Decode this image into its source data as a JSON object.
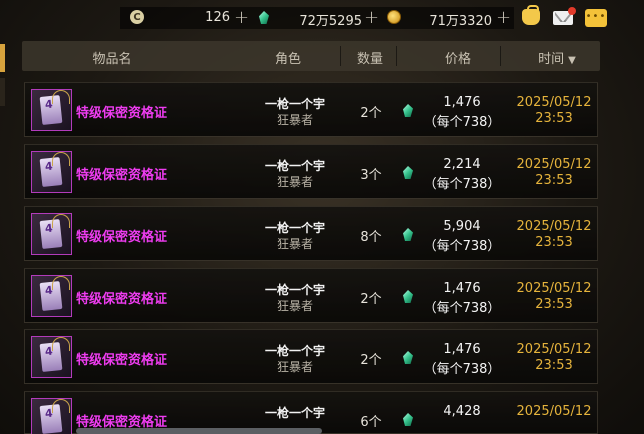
{
  "currencies": {
    "c_coin_label": "C",
    "c_coin_value": "126",
    "gem_value": "72万5295",
    "gold_value": "71万3320",
    "plus": "+"
  },
  "header_icons": {
    "chat_glyph": "•••"
  },
  "table": {
    "columns": [
      "物品名",
      "角色",
      "数量",
      "价格",
      "时间"
    ],
    "sort_indicator": "▼",
    "rows": [
      {
        "item": "特级保密资格证",
        "role": "一枪一个宇",
        "role_type": "狂暴者",
        "qty": "2个",
        "price": "1,476",
        "unit": "（每个738）",
        "date": "2025/05/12",
        "time": "23:53"
      },
      {
        "item": "特级保密资格证",
        "role": "一枪一个宇",
        "role_type": "狂暴者",
        "qty": "3个",
        "price": "2,214",
        "unit": "（每个738）",
        "date": "2025/05/12",
        "time": "23:53"
      },
      {
        "item": "特级保密资格证",
        "role": "一枪一个宇",
        "role_type": "狂暴者",
        "qty": "8个",
        "price": "5,904",
        "unit": "（每个738）",
        "date": "2025/05/12",
        "time": "23:53"
      },
      {
        "item": "特级保密资格证",
        "role": "一枪一个宇",
        "role_type": "狂暴者",
        "qty": "2个",
        "price": "1,476",
        "unit": "（每个738）",
        "date": "2025/05/12",
        "time": "23:53"
      },
      {
        "item": "特级保密资格证",
        "role": "一枪一个宇",
        "role_type": "狂暴者",
        "qty": "2个",
        "price": "1,476",
        "unit": "（每个738）",
        "date": "2025/05/12",
        "time": "23:53"
      },
      {
        "item": "特级保密资格证",
        "role": "一枪一个宇",
        "role_type": "",
        "qty": "6个",
        "price": "4,428",
        "unit": "",
        "date": "2025/05/12",
        "time": ""
      }
    ]
  },
  "thumbnail_number": "4",
  "colors": {
    "item_name": "#ee3cf0",
    "date": "#e6b43c",
    "gem": "#37c48e"
  }
}
